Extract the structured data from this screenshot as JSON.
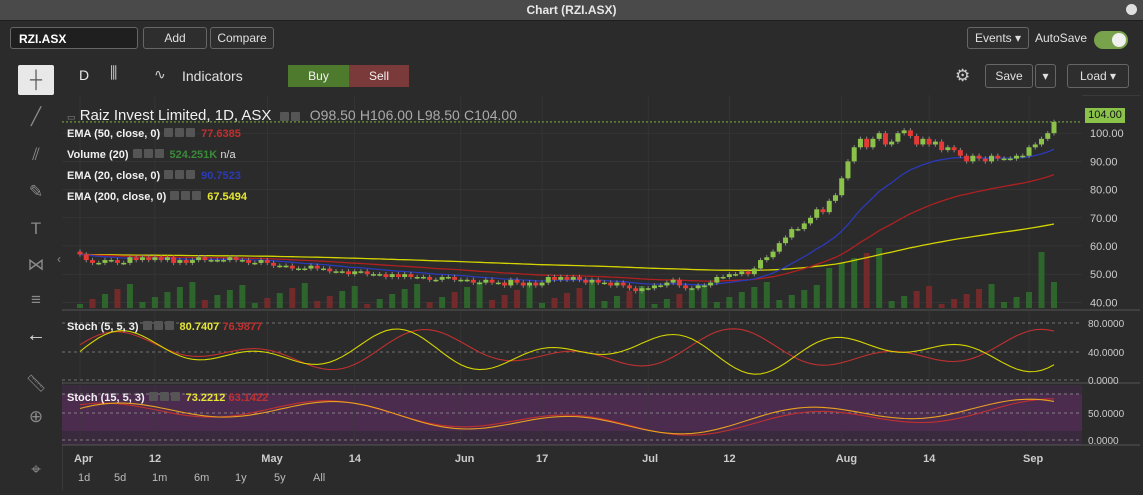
{
  "window": {
    "title": "Chart (RZI.ASX)"
  },
  "toolbar": {
    "symbol": "RZI.ASX",
    "add_label": "Add",
    "compare_label": "Compare",
    "events_label": "Events",
    "autosave_label": "AutoSave",
    "autosave_on": true,
    "interval_label": "D",
    "indicators_label": "Indicators",
    "buy_label": "Buy",
    "sell_label": "Sell",
    "save_label": "Save",
    "load_label": "Load",
    "buy_color": "#4d7a2d",
    "sell_color": "#7a3a3a"
  },
  "left_tools": [
    "crosshair-icon",
    "trend-line-icon",
    "pitchfork-icon",
    "brush-icon",
    "text-icon",
    "pattern-icon",
    "fib-icon",
    "back-arrow-icon",
    "ruler-icon",
    "zoom-icon",
    "magnet-icon"
  ],
  "header": {
    "name": "Raiz Invest Limited, 1D, ASX",
    "o_label": "O",
    "o": "98.50",
    "h_label": "H",
    "h": "106.00",
    "l_label": "L",
    "l": "98.50",
    "c_label": "C",
    "c": "104.00"
  },
  "indicators": [
    {
      "label": "EMA (50, close, 0)",
      "value": "77.6385",
      "value2": "",
      "color": "#c03030"
    },
    {
      "label": "Volume (20)",
      "value": "524.251K",
      "value2": "n/a",
      "color": "#3a8a3a"
    },
    {
      "label": "EMA (20, close, 0)",
      "value": "90.7523",
      "value2": "",
      "color": "#2a3ab8"
    },
    {
      "label": "EMA (200, close, 0)",
      "value": "67.5494",
      "value2": "",
      "color": "#e6e633"
    }
  ],
  "stoch1": {
    "label": "Stoch (5, 5, 3)",
    "k": "80.7407",
    "d": "76.9877"
  },
  "stoch2": {
    "label": "Stoch (15, 5, 3)",
    "k": "73.2212",
    "d": "63.1422"
  },
  "ranges": [
    "1d",
    "5d",
    "1m",
    "6m",
    "1y",
    "5y",
    "All"
  ],
  "chart_data": {
    "type": "candlestick",
    "title": "Raiz Invest Limited, 1D, ASX",
    "last_price": "104.00",
    "y_ticks": [
      "100.00",
      "90.00",
      "80.00",
      "70.00",
      "60.00",
      "50.00",
      "40.00"
    ],
    "ylim": [
      38,
      110
    ],
    "x_ticks": [
      "Apr",
      "12",
      "May",
      "14",
      "Jun",
      "17",
      "Jul",
      "12",
      "Aug",
      "14",
      "Sep"
    ],
    "x_tick_days": [
      0,
      12,
      30,
      44,
      61,
      74,
      91,
      104,
      122,
      136,
      152
    ],
    "closes": [
      57,
      55,
      54,
      54,
      55,
      55,
      54,
      54,
      56,
      55,
      56,
      55,
      56,
      55,
      56,
      54,
      55,
      54,
      55,
      56,
      55,
      55,
      55,
      55,
      56,
      55,
      55,
      54,
      54,
      55,
      54,
      53,
      53,
      53,
      52,
      52,
      52,
      53,
      52,
      52,
      51,
      51,
      51,
      50,
      51,
      51,
      50,
      50,
      50,
      49,
      50,
      49,
      50,
      49,
      49,
      49,
      48,
      48,
      49,
      49,
      48,
      48,
      48,
      47,
      47,
      48,
      47,
      47,
      46,
      48,
      47,
      46,
      47,
      46,
      47,
      49,
      48,
      49,
      48,
      49,
      48,
      47,
      48,
      47,
      47,
      46,
      47,
      46,
      45,
      44,
      45,
      45,
      46,
      46,
      47,
      48,
      46,
      45,
      45,
      46,
      46,
      47,
      49,
      49,
      50,
      50,
      51,
      50,
      52,
      55,
      56,
      58,
      61,
      63,
      66,
      66,
      68,
      70,
      73,
      72,
      76,
      78,
      84,
      90,
      95,
      98,
      95,
      98,
      100,
      96,
      97,
      100,
      101,
      99,
      96,
      98,
      96,
      97,
      94,
      95,
      94,
      92,
      90,
      92,
      91,
      90,
      92,
      91,
      91,
      91,
      92,
      92,
      95,
      96,
      98,
      100,
      104
    ],
    "ema_20_last": 90.7523,
    "ema_50_last": 77.6385,
    "ema_200_last": 67.5494,
    "volume_label": "Volume (20)",
    "volume_last": "524.251K",
    "stoch1_ticks": [
      "80.0000",
      "40.0000",
      "0.0000"
    ],
    "stoch2_ticks": [
      "50.0000",
      "0.0000"
    ]
  },
  "colors": {
    "up": "#8bc34a",
    "down": "#e53935",
    "ema20": "#2a3ab8",
    "ema50": "#b02020",
    "ema200": "#d4d400",
    "grid": "#3a3a3a"
  }
}
